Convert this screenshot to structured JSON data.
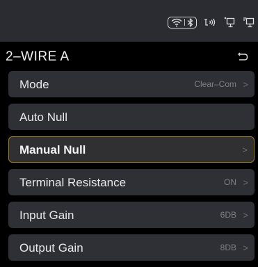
{
  "status_bar": {
    "icons": [
      "wifi-icon",
      "bluetooth-icon",
      "nfc-icon",
      "network-port-icon",
      "ethernet-port-icon"
    ]
  },
  "header": {
    "title": "2–WIRE A"
  },
  "menu": {
    "items": [
      {
        "label": "Mode",
        "value": "Clear–Com",
        "chevron": ">"
      },
      {
        "label": "Auto Null",
        "value": "",
        "chevron": ""
      },
      {
        "label": "Manual Null",
        "value": "",
        "chevron": ">"
      },
      {
        "label": "Terminal Resistance",
        "value": "ON",
        "chevron": ">"
      },
      {
        "label": "Input Gain",
        "value": "6DB",
        "chevron": ">"
      },
      {
        "label": "Output Gain",
        "value": "8DB",
        "chevron": ">"
      }
    ],
    "selected_index": 2
  },
  "colors": {
    "background": "#000000",
    "status_bar": "#2a2c31",
    "item_background": "#2f3035",
    "selected_border": "#9a7a26",
    "value_text": "#7e7f84"
  }
}
